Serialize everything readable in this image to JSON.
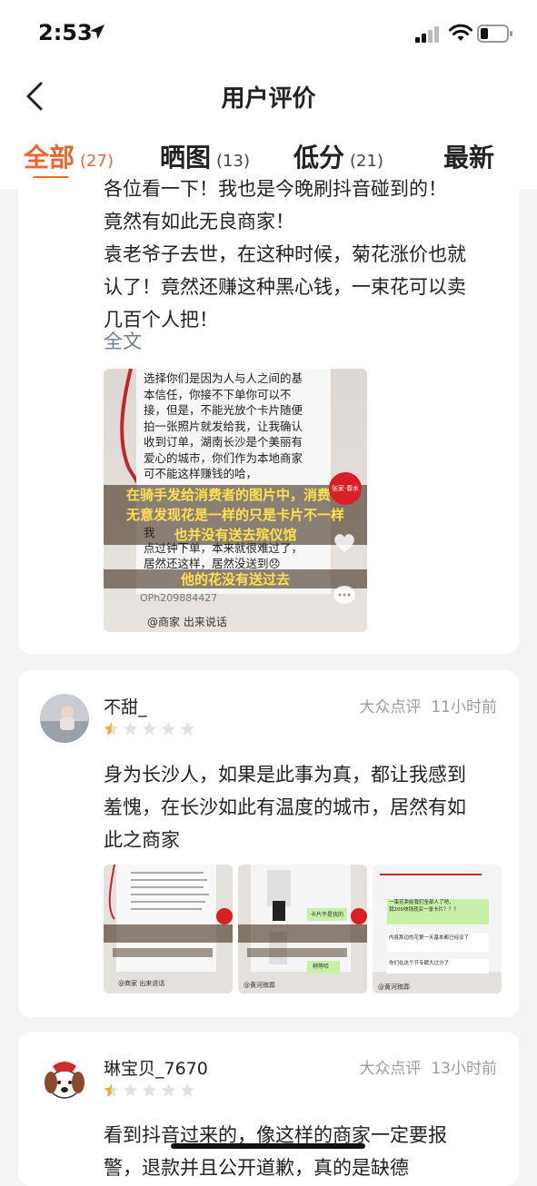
{
  "status": {
    "time": "2:53"
  },
  "nav": {
    "title": "用户评价"
  },
  "tabs": [
    {
      "label": "全部",
      "count": "(27)"
    },
    {
      "label": "晒图",
      "count": "(13)"
    },
    {
      "label": "低分",
      "count": "(21)"
    },
    {
      "label": "最新",
      "count": ""
    }
  ],
  "reviews": [
    {
      "text_lines": [
        "各位看一下！我也是今晚刷抖音碰到的！",
        "竟然有如此无良商家！",
        "袁老爷子去世，在这种时候，菊花涨价也就",
        "认了！竟然还赚这种黑心钱，一束花可以卖",
        "几百个人把！"
      ],
      "more_label": "全文",
      "image": {
        "chat_lines": [
          "选择你们是因为人与人之间的基",
          "本信任，你接不下单你可以不",
          "接，但是，不能光放个卡片随便",
          "拍一张照片就发给我，让我确认",
          "收到订单，湖南长沙是个美丽有",
          "爱心的城市，你们作为本地商家",
          "可不能这样赚钱的哈，"
        ],
        "overlay_lines": [
          "在骑手发给消费者的图片中，消费者",
          "无意发现花是一样的只是卡片不一样",
          "也并没有送去殡仪馆"
        ],
        "chat_lines_2": [
          "我",
          "点过钟下单，本来就很难过了，",
          "居然还这样，居然没送到😞"
        ],
        "overlay_bottom": "他的花没有送过去",
        "order_id": "OPh209884427",
        "caption": "@商家 出来说话",
        "stamp": "张家·春水"
      }
    },
    {
      "user": "不甜_",
      "source": "大众点评",
      "time_ago": "11小时前",
      "rating": 0.5,
      "text_lines": [
        "身为长沙人，如果是此事为真，都让我感到",
        "羞愧，在长沙如此有温度的城市，居然有如",
        "此之商家"
      ],
      "thumbs": [
        {
          "caption": "@商家 出来说话"
        },
        {
          "caption": "@黄河殡葬",
          "bubble1": "卡片不是我的",
          "bubble2": "稍等哈"
        },
        {
          "caption": "@黄河殡葬",
          "lines": [
            "一束花卖给我们全部人了吧，",
            "我200块钱就买一张卡片？？？",
            "内县那边的花第一天基本都已经没了",
            "你们在这个节专戳大过分了"
          ]
        }
      ]
    },
    {
      "user": "琳宝贝_7670",
      "source": "大众点评",
      "time_ago": "13小时前",
      "rating": 0.5,
      "text_lines": [
        "看到抖音过来的，像这样的商家一定要报",
        "警，退款并且公开道歉，真的是缺德"
      ]
    }
  ],
  "colors": {
    "accent": "#ef6a2c",
    "star_gold": "#f5a623",
    "star_grey": "#e2e2e2",
    "link": "#6a7c92"
  }
}
